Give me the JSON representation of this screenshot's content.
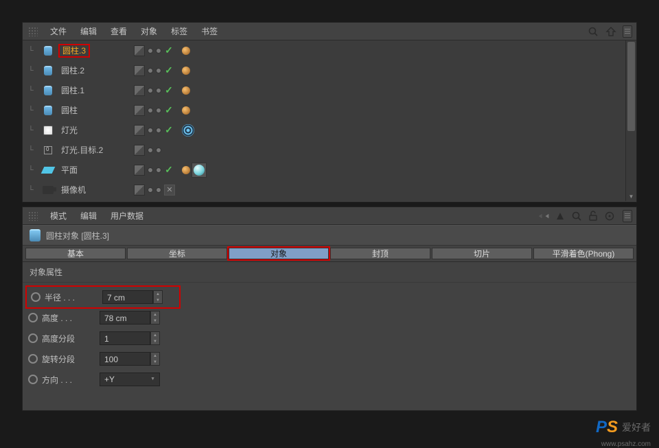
{
  "obj_menu": {
    "file": "文件",
    "edit": "编辑",
    "view": "查看",
    "objects": "对象",
    "tags": "标签",
    "bookmarks": "书签"
  },
  "tree": [
    {
      "name": "圆柱.3",
      "key": "cyl3",
      "icon": "cylinder",
      "selected": true,
      "red": true,
      "tags": [
        "orange"
      ],
      "vis": true
    },
    {
      "name": "圆柱.2",
      "key": "cyl2",
      "icon": "cylinder",
      "tags": [
        "orange"
      ],
      "vis": true
    },
    {
      "name": "圆柱.1",
      "key": "cyl1",
      "icon": "cylinder",
      "tags": [
        "orange"
      ],
      "vis": true
    },
    {
      "name": "圆柱",
      "key": "cyl0",
      "icon": "cylinder",
      "tags": [
        "orange"
      ],
      "vis": true
    },
    {
      "name": "灯光",
      "key": "light",
      "icon": "light",
      "tags": [
        "target"
      ],
      "vis": true
    },
    {
      "name": "灯光.目标.2",
      "key": "lighttarget",
      "icon": "null",
      "tags": [],
      "vis": false
    },
    {
      "name": "平面",
      "key": "plane",
      "icon": "plane",
      "tags": [
        "orange",
        "material"
      ],
      "vis": true
    },
    {
      "name": "摄像机",
      "key": "cam",
      "icon": "camera",
      "tags": [],
      "vis": false,
      "expand": true
    }
  ],
  "attr_menu": {
    "mode": "模式",
    "edit": "编辑",
    "userdata": "用户数据"
  },
  "obj_header": "圆柱对象 [圆柱.3]",
  "tabs": {
    "basic": "基本",
    "coord": "坐标",
    "object": "对象",
    "cap": "封顶",
    "slice": "切片",
    "phong": "平滑着色(Phong)"
  },
  "section_title": "对象属性",
  "props": {
    "radius": {
      "label": "半径 . . .",
      "value": "7 cm"
    },
    "height": {
      "label": "高度 . . .",
      "value": "78 cm"
    },
    "hseg": {
      "label": "高度分段",
      "value": "1"
    },
    "rseg": {
      "label": "旋转分段",
      "value": "100"
    },
    "dir": {
      "label": "方向 . . .",
      "value": "+Y"
    }
  },
  "watermark": {
    "brand_p": "P",
    "brand_s": "S",
    "text": "爱好者",
    "url": "www.psahz.com"
  }
}
